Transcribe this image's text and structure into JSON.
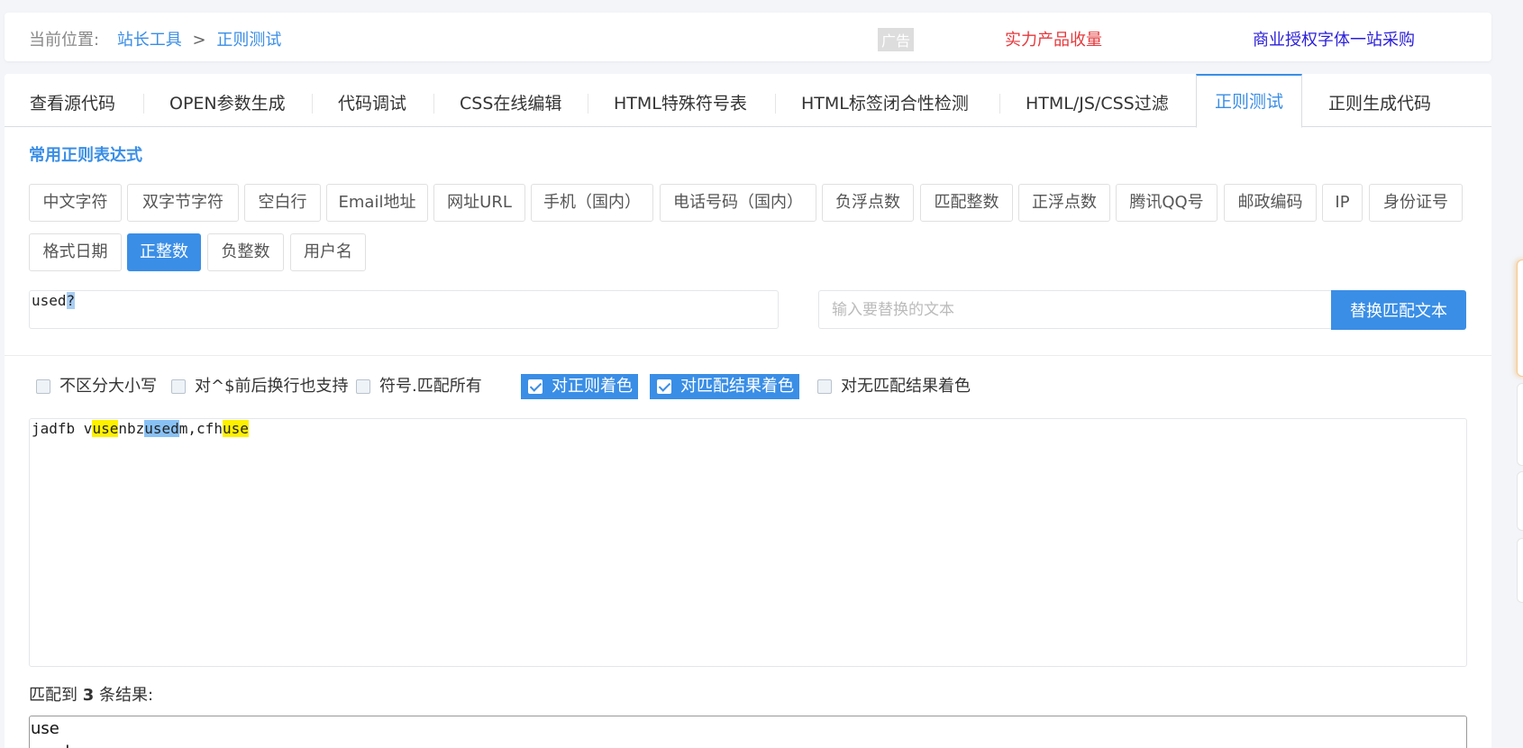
{
  "breadcrumb": {
    "prefix": "当前位置:",
    "home": "站长工具",
    "separator": ">",
    "current": "正则测试"
  },
  "ads": {
    "badge": "广告",
    "link1": "实力产品收量",
    "link2": "商业授权字体一站采购",
    "link1_color": "#e4393c",
    "link2_color": "#2a1ed8"
  },
  "tabs": [
    {
      "label": "查看源代码"
    },
    {
      "label": "OPEN参数生成"
    },
    {
      "label": "代码调试"
    },
    {
      "label": "CSS在线编辑"
    },
    {
      "label": "HTML特殊符号表"
    },
    {
      "label": "HTML标签闭合性检测"
    },
    {
      "label": "HTML/JS/CSS过滤"
    },
    {
      "label": "正则测试",
      "active": true
    },
    {
      "label": "正则生成代码"
    }
  ],
  "section_title": "常用正则表达式",
  "presets": [
    "中文字符",
    "双字节字符",
    "空白行",
    "Email地址",
    "网址URL",
    "手机（国内）",
    "电话号码（国内）",
    "负浮点数",
    "匹配整数",
    "正浮点数",
    "腾讯QQ号",
    "邮政编码",
    "IP",
    "身份证号",
    "格式日期",
    "正整数",
    "负整数",
    "用户名"
  ],
  "active_preset": "正整数",
  "regex": {
    "plain": "used",
    "highlighted": "?"
  },
  "replace": {
    "placeholder": "输入要替换的文本",
    "button": "替换匹配文本"
  },
  "options": [
    {
      "label": "不区分大小写",
      "checked": false
    },
    {
      "label": "对^$前后换行也支持",
      "checked": false
    },
    {
      "label": "符号.匹配所有",
      "checked": false
    },
    {
      "label": "对正则着色",
      "checked": true
    },
    {
      "label": "对匹配结果着色",
      "checked": true
    },
    {
      "label": "对无匹配结果着色",
      "checked": false
    }
  ],
  "test_text": {
    "seg1": "jadfb v",
    "m1": "use",
    "seg2": "nbz",
    "m2": "used",
    "seg3": "m,cfh",
    "m3": "use"
  },
  "result": {
    "prefix": "匹配到",
    "count": "3",
    "suffix": "条结果:",
    "items": [
      "use",
      "used"
    ]
  },
  "colors": {
    "accent": "#3a8ee6",
    "match_yellow": "#fff100",
    "match_blue": "#88c1f5"
  }
}
